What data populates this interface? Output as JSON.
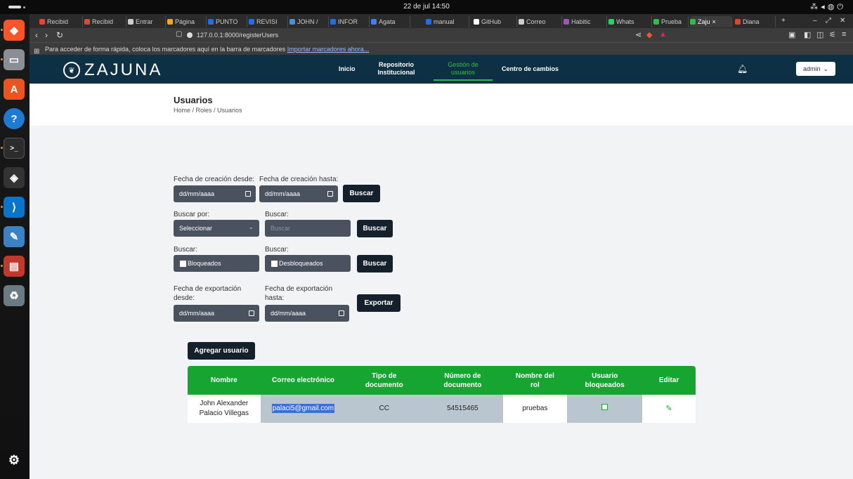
{
  "os": {
    "clock": "22 de jul  14:50"
  },
  "tabs": [
    {
      "label": "Recibid",
      "color": "#ea4335"
    },
    {
      "label": "Recibid",
      "color": "#ea4335"
    },
    {
      "label": "Entrar",
      "color": "#cccccc"
    },
    {
      "label": "Página",
      "color": "#f5a623"
    },
    {
      "label": "PUNTO",
      "color": "#1f6feb"
    },
    {
      "label": "REVISI",
      "color": "#1f6feb"
    },
    {
      "label": "JOHN /",
      "color": "#4a90d9"
    },
    {
      "label": "INFOR",
      "color": "#1f6feb"
    },
    {
      "label": "Agata",
      "color": "#3b82f6"
    },
    {
      "label": "manual",
      "color": "#1f6feb"
    },
    {
      "label": "GitHub",
      "color": "#ffffff"
    },
    {
      "label": "Correo",
      "color": "#cccccc"
    },
    {
      "label": "Habitic",
      "color": "#9b59b6"
    },
    {
      "label": "Whats",
      "color": "#25d366"
    },
    {
      "label": "Prueba",
      "color": "#2fbd4a"
    },
    {
      "label": "Zaju",
      "color": "#2fbd4a"
    },
    {
      "label": "Diana",
      "color": "#e24329"
    }
  ],
  "browser": {
    "url": "127.0.0.1:8000/registerUsers",
    "bookmarks_text": "Para acceder de forma rápida, coloca los marcadores aquí en la barra de marcadores",
    "bookmarks_link": "Importar marcadores ahora..."
  },
  "header": {
    "logo": "ZAJUNA",
    "menu": {
      "inicio": "Inicio",
      "repo_1": "Repositorio",
      "repo_2": "Institucional",
      "gestion_1": "Gestión de",
      "gestion_2": "usuarios",
      "cambios": "Centro de cambios"
    },
    "user": "admin"
  },
  "page": {
    "title": "Usuarios",
    "breadcrumb": "Home / Roles / Usuarios"
  },
  "filters": {
    "fecha_desde_label": "Fecha de creación desde:",
    "fecha_hasta_label": "Fecha de creación hasta:",
    "date_placeholder": "dd/mm/aaaa",
    "buscar_btn": "Buscar",
    "buscar_por_label": "Buscar por:",
    "buscar_label": "Buscar:",
    "select_value": "Seleccionar",
    "search_placeholder": "Buscar",
    "bloqueados": "Bloqueados",
    "desbloqueados": "Desbloqueados",
    "export_desde_1": "Fecha de exportación",
    "export_desde_2": "desde:",
    "export_hasta_1": "Fecha de exportación",
    "export_hasta_2": "hasta:",
    "exportar_btn": "Exportar"
  },
  "add_user_btn": "Agregar usuario",
  "table": {
    "headers": {
      "nombre": "Nombre",
      "correo": "Correo electrónico",
      "tipo_1": "Tipo de",
      "tipo_2": "documento",
      "numero_1": "Número de",
      "numero_2": "documento",
      "rol_1": "Nombre del",
      "rol_2": "rol",
      "bloq_1": "Usuario",
      "bloq_2": "bloqueados",
      "editar": "Editar"
    },
    "rows": [
      {
        "nombre_1": "John Alexander",
        "nombre_2": "Palacio Villegas",
        "correo": "palaci5@gmail.com",
        "tipo": "CC",
        "numero": "54515465",
        "rol": "pruebas",
        "bloqueado": false
      }
    ]
  },
  "colors": {
    "header_bg": "#0d3044",
    "accent_green": "#17a532",
    "field_bg": "#4a5260",
    "button_bg": "#14202c"
  }
}
